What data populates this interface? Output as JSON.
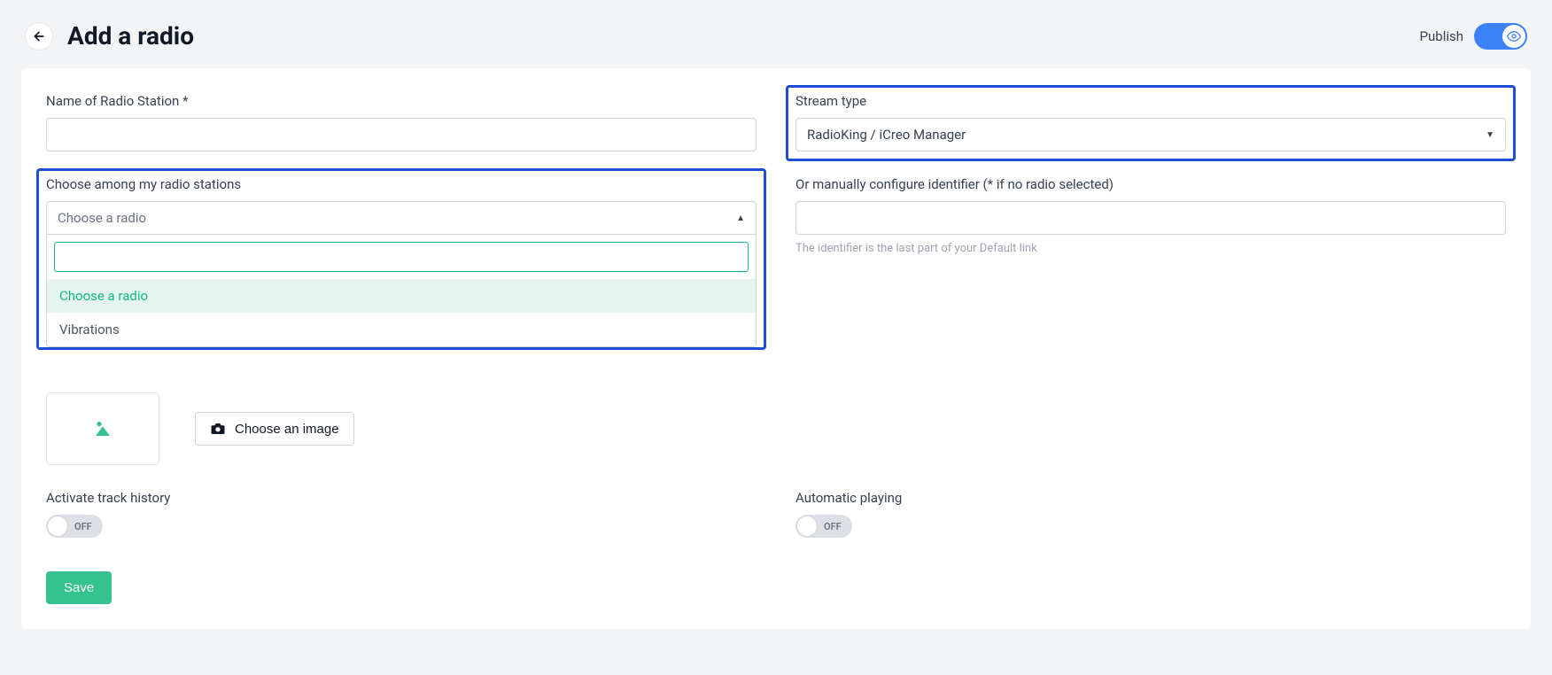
{
  "header": {
    "title": "Add a radio",
    "publish_label": "Publish"
  },
  "form": {
    "name_label": "Name of Radio Station *",
    "name_value": "",
    "stream_type_label": "Stream type",
    "stream_type_value": "RadioKing / iCreo Manager",
    "choose_station_label": "Choose among my radio stations",
    "choose_station_placeholder": "Choose a radio",
    "identifier_label": "Or manually configure identifier (* if no radio selected)",
    "identifier_value": "",
    "identifier_helper": "The identifier is the last part of your Default link",
    "dropdown_options": [
      {
        "label": "Choose a radio",
        "selected": true
      },
      {
        "label": "Vibrations",
        "selected": false
      }
    ],
    "choose_image_label": "Choose an image",
    "track_history_label": "Activate track history",
    "track_history_value": "OFF",
    "auto_playing_label": "Automatic playing",
    "auto_playing_value": "OFF",
    "save_label": "Save"
  }
}
